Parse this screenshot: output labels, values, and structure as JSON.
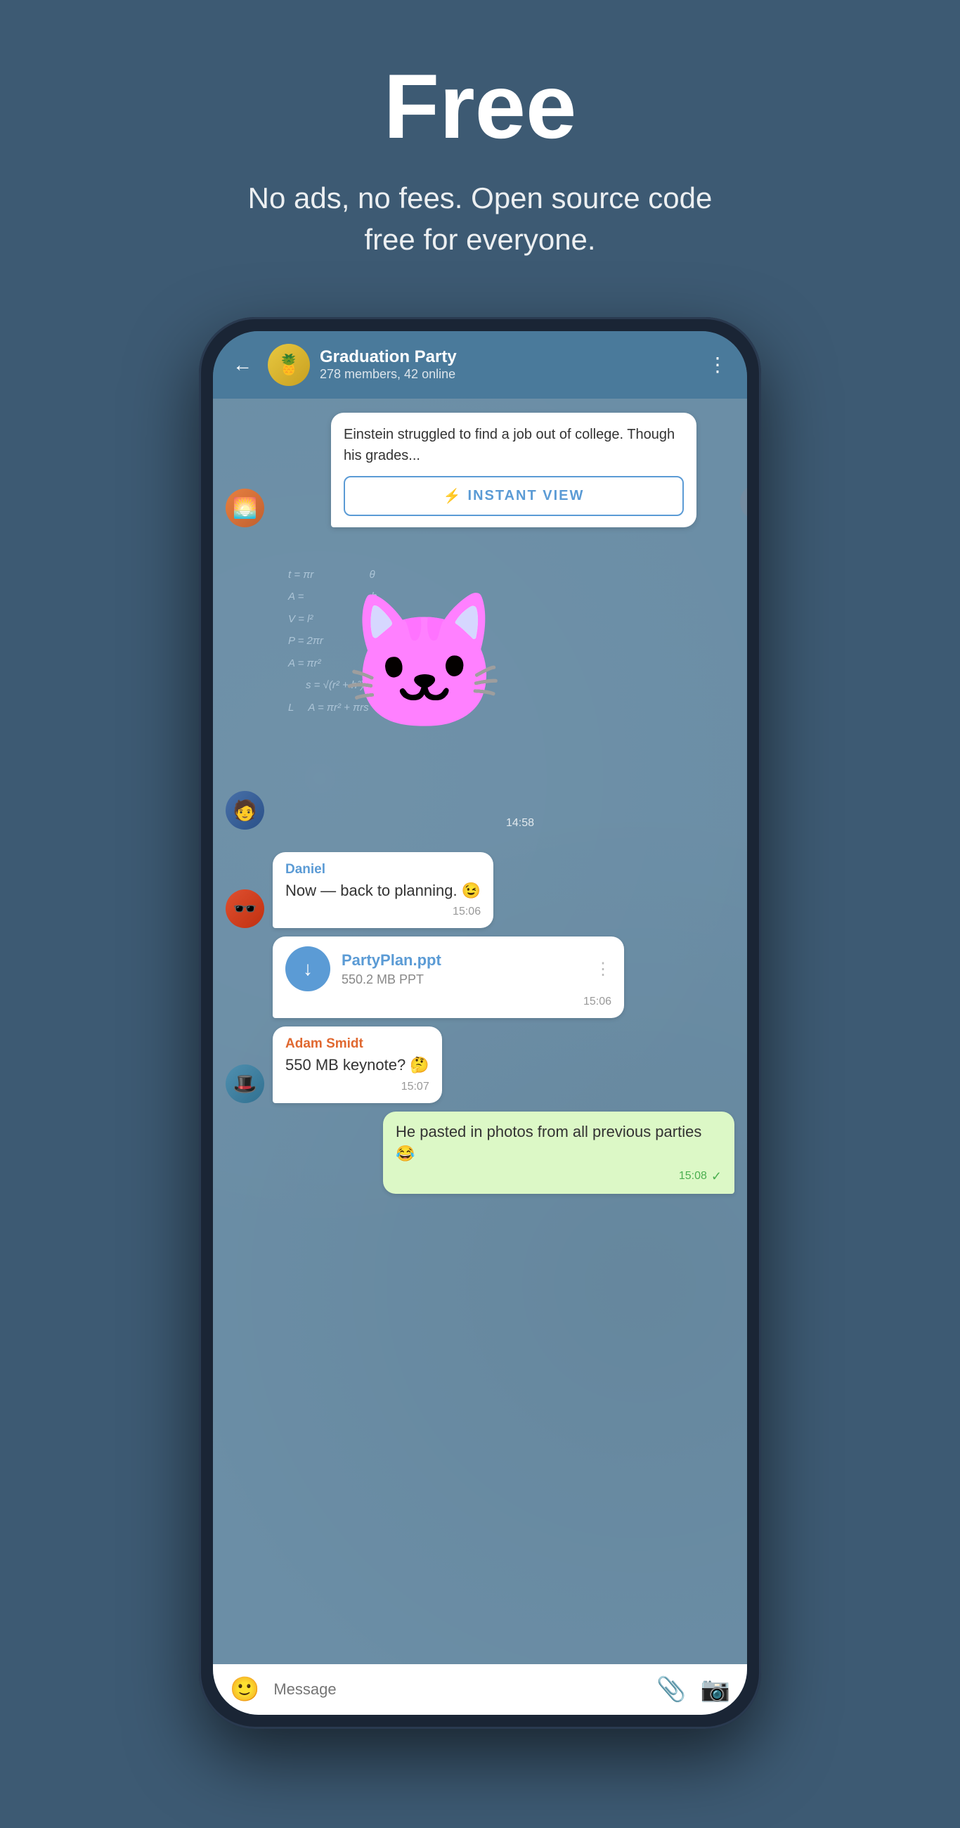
{
  "hero": {
    "title": "Free",
    "subtitle": "No ads, no fees. Open source code free for everyone."
  },
  "chat": {
    "back_label": "←",
    "group_name": "Graduation Party",
    "group_meta": "278 members, 42 online",
    "more_icon": "⋮",
    "avatar_emoji": "🍍"
  },
  "messages": [
    {
      "type": "article",
      "text": "Einstein struggled to find a job out of college. Though his grades...",
      "instant_view_label": "INSTANT VIEW",
      "share_icon": "↗"
    },
    {
      "type": "sticker",
      "time": "14:58"
    },
    {
      "type": "text",
      "sender": "Daniel",
      "sender_color": "blue",
      "text": "Now — back to planning. 😉",
      "time": "15:06"
    },
    {
      "type": "file",
      "filename": "PartyPlan.ppt",
      "filesize": "550.2 MB PPT",
      "time": "15:06",
      "download_icon": "↓"
    },
    {
      "type": "text",
      "sender": "Adam Smidt",
      "sender_color": "orange",
      "text": "550 MB keynote? 🤔",
      "time": "15:07"
    },
    {
      "type": "own",
      "text": "He pasted in photos from all previous parties 😂",
      "time": "15:08",
      "checkmark": "✓"
    }
  ],
  "input_bar": {
    "placeholder": "Message",
    "emoji_icon": "😊",
    "attach_icon": "📎",
    "camera_icon": "📷"
  },
  "math_lines": [
    "t = πr²",
    "A =",
    "V = l²",
    "P = 2πr",
    "A = πr²",
    "s = √(r² + h²)",
    "A = πr² + πrs"
  ]
}
